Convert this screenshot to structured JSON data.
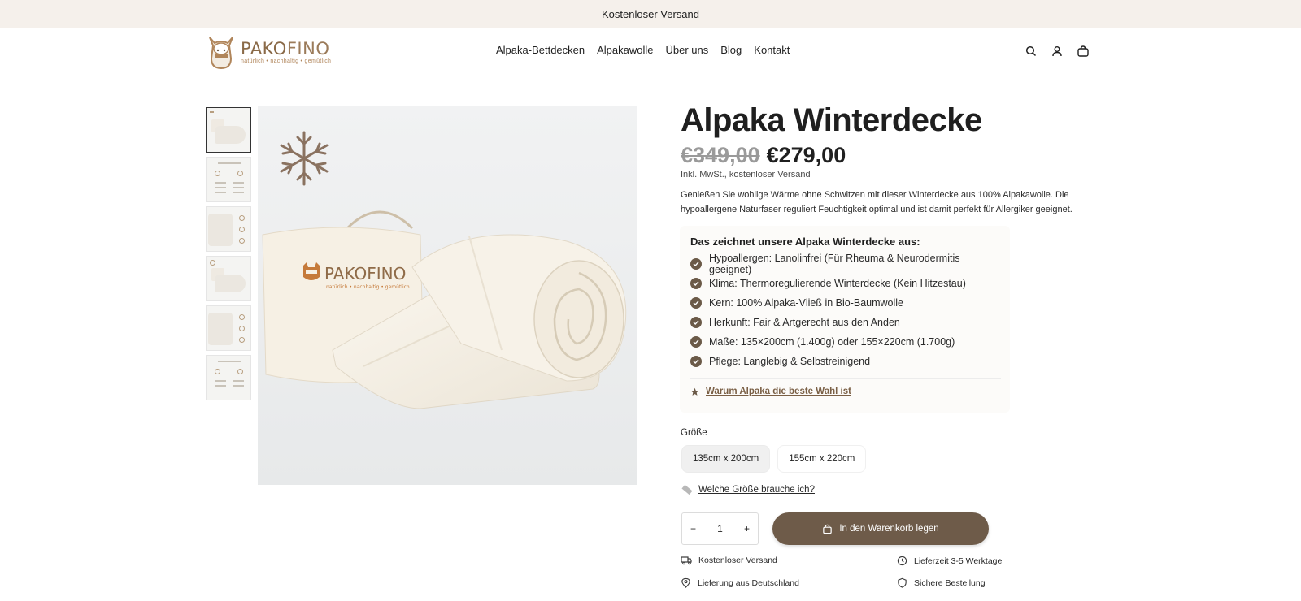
{
  "announcement": "Kostenloser Versand",
  "brand": {
    "name_part1": "PAKO",
    "name_part2": "FINO",
    "tagline": "natürlich • nachhaltig • gemütlich"
  },
  "nav": [
    "Alpaka-Bettdecken",
    "Alpakawolle",
    "Über uns",
    "Blog",
    "Kontakt"
  ],
  "header_icons": [
    "search-icon",
    "account-icon",
    "cart-icon"
  ],
  "product": {
    "title": "Alpaka Winterdecke",
    "price_old": "€349,00",
    "price_new": "€279,00",
    "tax_note": "Inkl. MwSt., kostenloser Versand",
    "description": "Genießen Sie wohlige Wärme ohne Schwitzen mit dieser Winterdecke aus 100% Alpakawolle. Die hypoallergene Naturfaser reguliert Feuchtigkeit optimal und ist damit perfekt für Allergiker geeignet.",
    "image_brand": "PAKOFINO",
    "image_tagline": "natürlich • nachhaltig • gemütlich"
  },
  "features": {
    "heading": "Das zeichnet unsere Alpaka Winterdecke aus:",
    "items": [
      "Hypoallergen: Lanolinfrei (Für Rheuma & Neurodermitis geeignet)",
      "Klima: Thermoregulierende Winterdecke (Kein Hitzestau)",
      "Kern: 100% Alpaka-Vließ in Bio-Baumwolle",
      "Herkunft: Fair & Artgerecht aus den Anden",
      "Maße: 135×200cm (1.400g) oder 155×220cm (1.700g)",
      "Pflege: Langlebig & Selbstreinigend"
    ],
    "link": "Warum Alpaka die beste Wahl ist"
  },
  "size": {
    "label": "Größe",
    "options": [
      "135cm x 200cm",
      "155cm x 220cm"
    ],
    "selected": "135cm x 200cm",
    "guide_link": "Welche Größe brauche ich?"
  },
  "quantity": {
    "minus": "−",
    "value": "1",
    "plus": "+"
  },
  "cart_button": "In den Warenkorb legen",
  "usps": [
    "Kostenloser Versand",
    "Lieferzeit 3-5 Werktage",
    "Lieferung aus Deutschland",
    "Sichere Bestellung"
  ],
  "colors": {
    "brand_brown": "#6e5b49",
    "announce_bg": "#f5f0eb",
    "logo_gold": "#b0855a"
  }
}
